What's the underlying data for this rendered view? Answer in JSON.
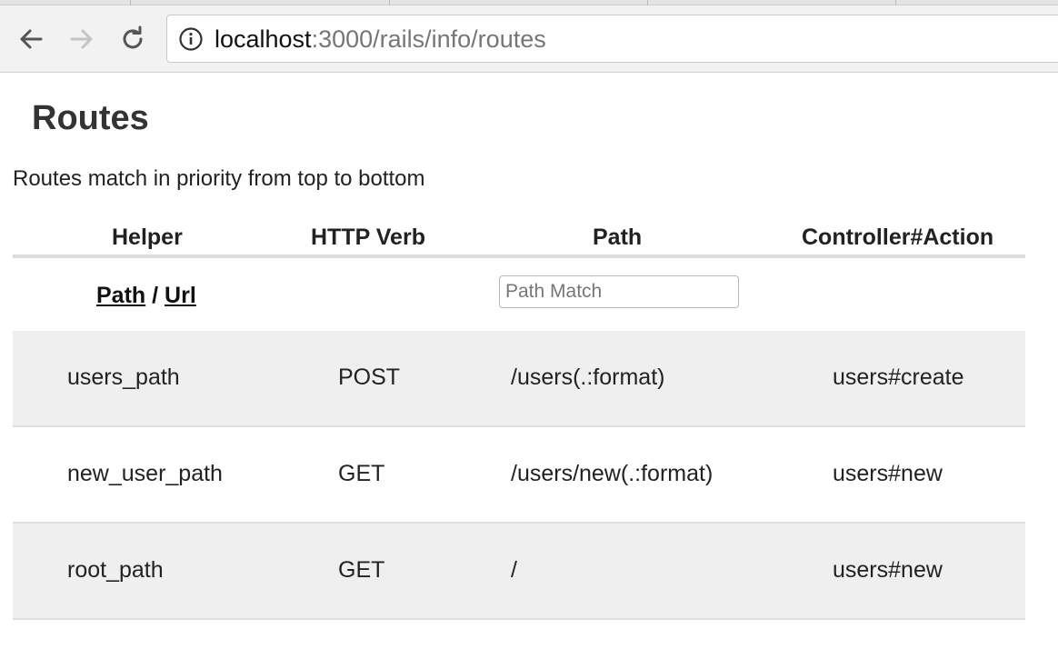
{
  "browser": {
    "url_host": "localhost",
    "url_rest": ":3000/rails/info/routes"
  },
  "page": {
    "title": "Routes",
    "subtitle": "Routes match in priority from top to bottom"
  },
  "table": {
    "headers": [
      "Helper",
      "HTTP Verb",
      "Path",
      "Controller#Action"
    ],
    "filter": {
      "path_link": "Path",
      "separator": "/",
      "url_link": "Url",
      "path_match_placeholder": "Path Match"
    },
    "rows": [
      {
        "helper": "users_path",
        "verb": "POST",
        "path": "/users(.:format)",
        "action": "users#create"
      },
      {
        "helper": "new_user_path",
        "verb": "GET",
        "path": "/users/new(.:format)",
        "action": "users#new"
      },
      {
        "helper": "root_path",
        "verb": "GET",
        "path": "/",
        "action": "users#new"
      }
    ]
  }
}
